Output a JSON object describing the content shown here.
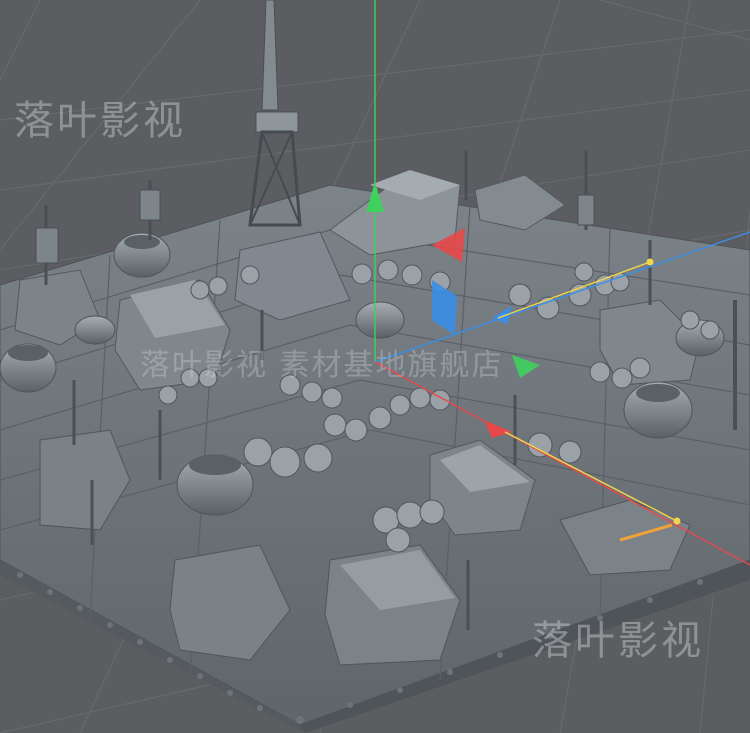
{
  "viewport": {
    "background": "#5b5d60",
    "grid_color": "#6a6c70",
    "model_color": "#8a9096"
  },
  "axes": {
    "x_color": "#e8484a",
    "y_color": "#3fd15f",
    "z_color": "#3a8ee6",
    "handle_line_color": "#f2d64a"
  },
  "watermarks": {
    "top_left": "落叶影视",
    "center": "落叶影视 素材基地旗舰店",
    "bottom_right": "落叶影视"
  },
  "icons": {
    "gizmo_y": "arrow-up-icon",
    "gizmo_x": "arrow-right-icon",
    "gizmo_z": "arrow-depth-icon"
  }
}
